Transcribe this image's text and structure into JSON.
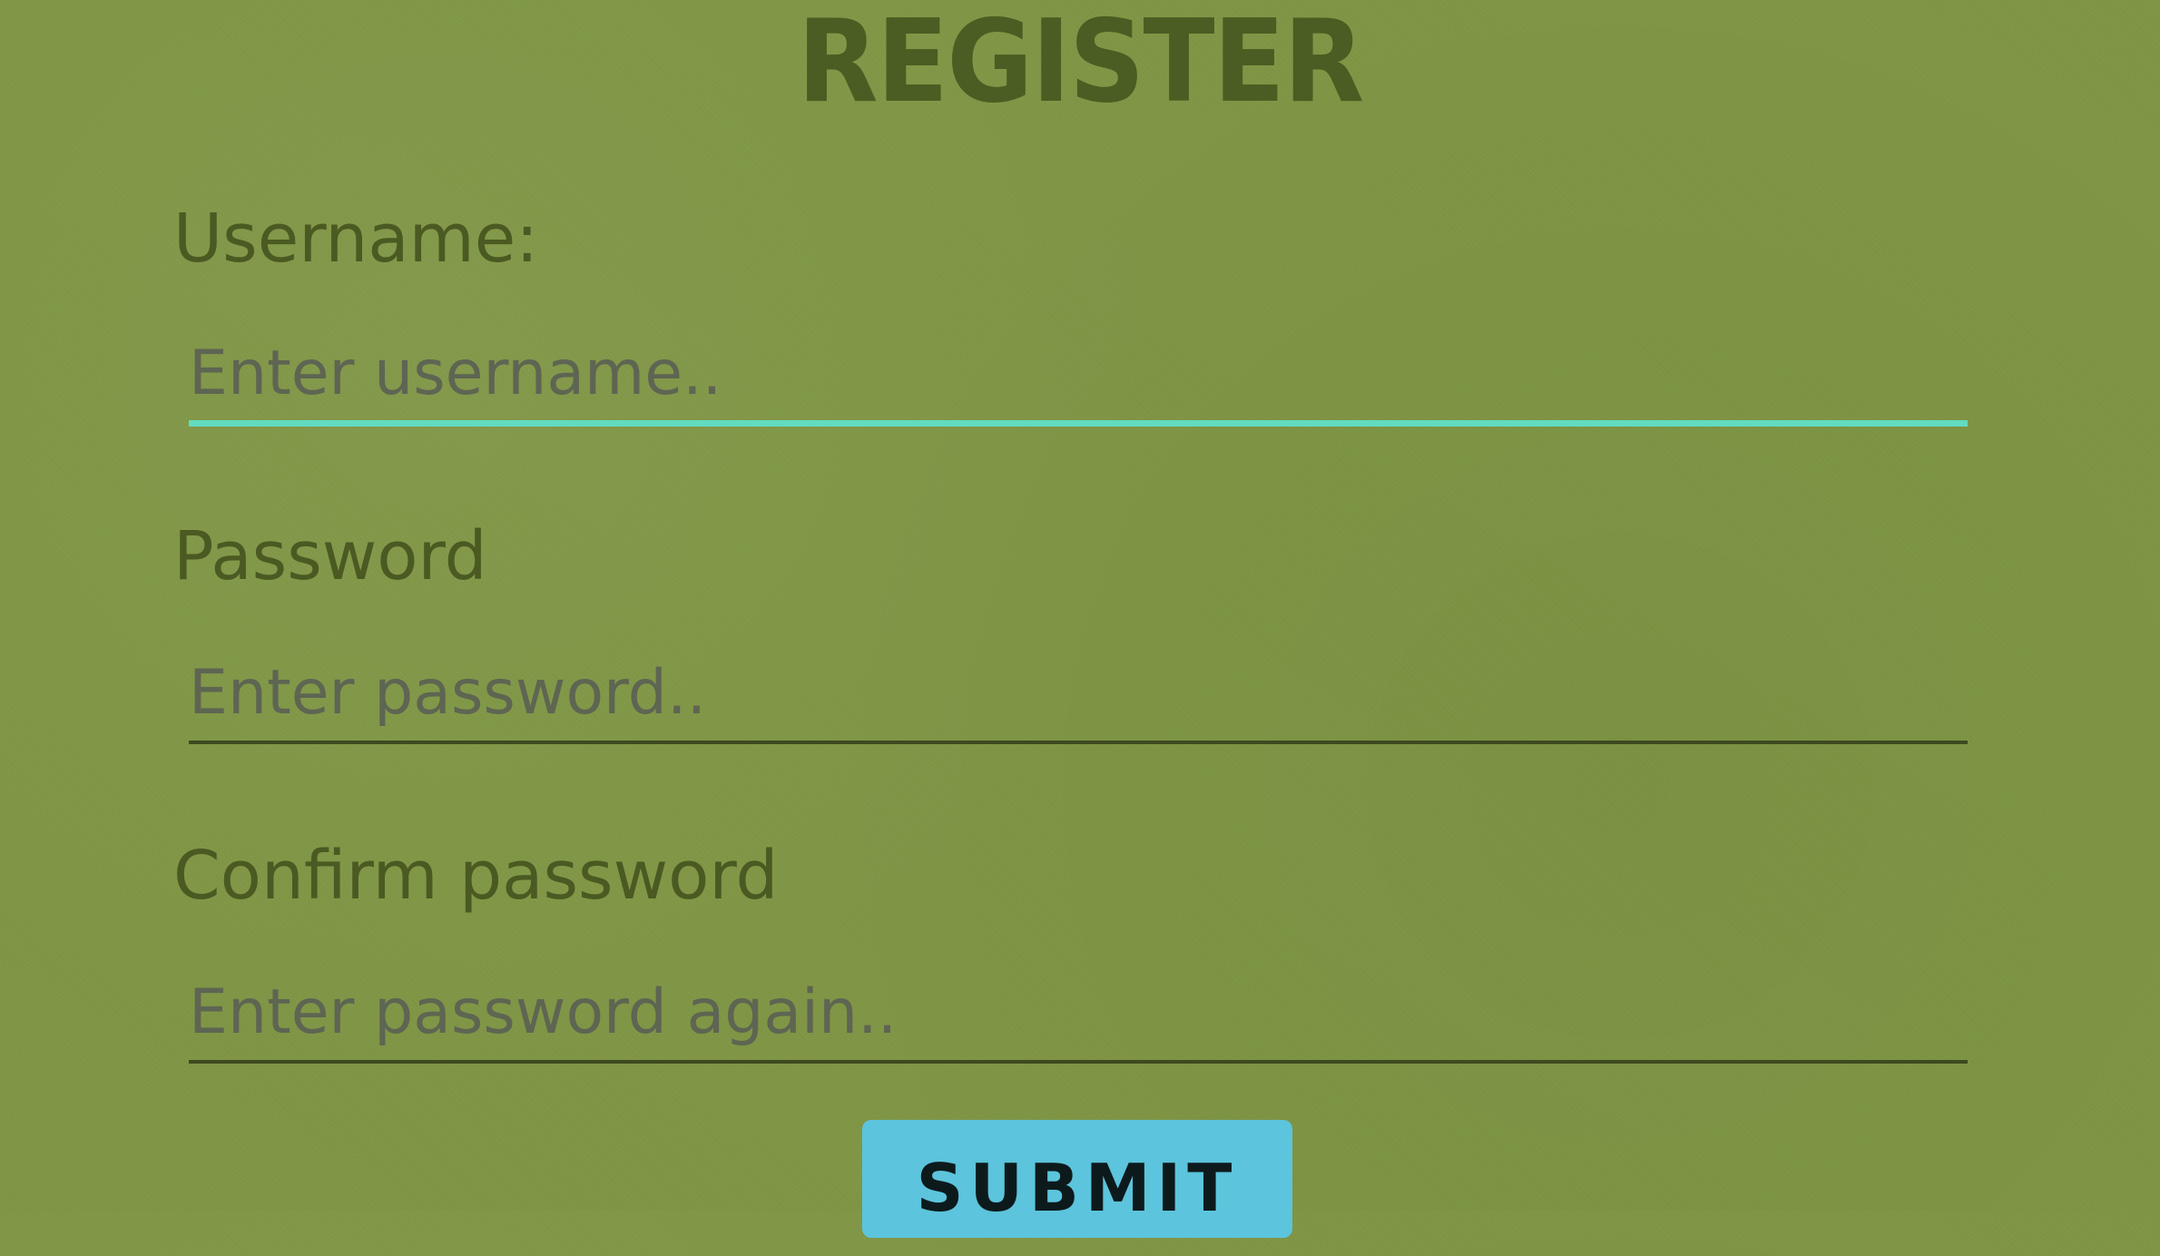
{
  "form": {
    "title": "REGISTER",
    "fields": [
      {
        "label": "Username:",
        "placeholder": "Enter username..",
        "value": "",
        "focused": true
      },
      {
        "label": "Password",
        "placeholder": "Enter password..",
        "value": "",
        "focused": false
      },
      {
        "label": "Confirm password",
        "placeholder": "Enter password again..",
        "value": "",
        "focused": false
      }
    ],
    "submit_label": "SUBMIT"
  },
  "colors": {
    "background": "#7f9645",
    "title": "#4b5d22",
    "label": "#4a5a22",
    "placeholder": "#5e6552",
    "focus_underline": "#62dcc0",
    "underline": "#3d4a20",
    "submit_background": "#5cc4dc",
    "submit_text": "#0d1a1c"
  }
}
